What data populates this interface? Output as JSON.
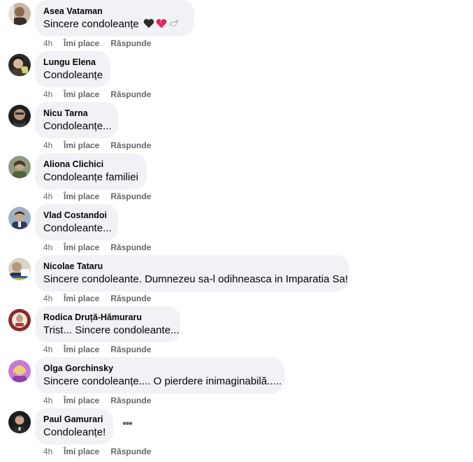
{
  "meta": {
    "time_label": "4h",
    "like_label": "Îmi place",
    "reply_label": "Răspunde",
    "more_label": "•••"
  },
  "comments": [
    {
      "author": "Asea Vataman",
      "text": "Sincere condoleanțe",
      "emojis": [
        "black-heart-emoji",
        "broken-heart-emoji",
        "dove-emoji"
      ]
    },
    {
      "author": "Lungu Elena",
      "text": "Condoleanțe"
    },
    {
      "author": "Nicu Tarna",
      "text": "Condoleanțe..."
    },
    {
      "author": "Aliona Clichici",
      "text": "Condoleanțe familiei"
    },
    {
      "author": "Vlad Costandoi",
      "text": "Condoleante..."
    },
    {
      "author": "Nicolae Tataru",
      "text": "Sincere condoleante. Dumnezeu sa-l odihneasca in Imparatia Sa!"
    },
    {
      "author": "Rodica Druță-Hămuraru",
      "text": "Trist... Sincere condoleante..."
    },
    {
      "author": "Olga Gorchinsky",
      "text": "Sincere condoleanțe.... O pierdere inimaginabilă....."
    },
    {
      "author": "Paul Gamurari",
      "text": "Condoleanțe!"
    }
  ]
}
